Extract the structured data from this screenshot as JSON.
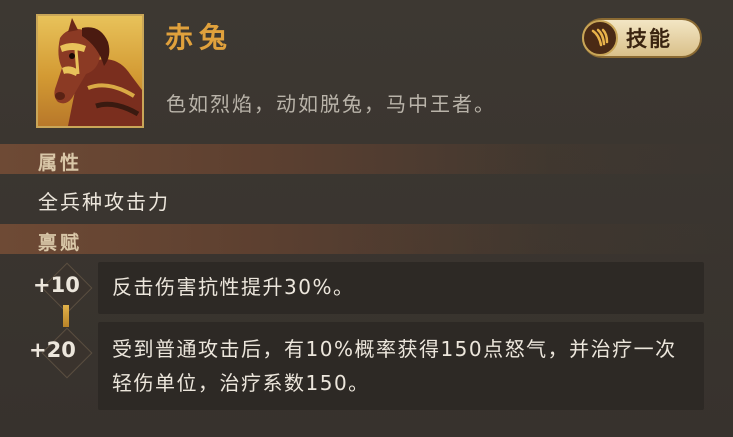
{
  "card": {
    "name": "赤兔",
    "description": "色如烈焰，动如脱兔，马中王者。",
    "skill_button_label": "技能",
    "skill_icon": "claw-icon",
    "portrait": "horse-portrait"
  },
  "attributes": {
    "title": "属性",
    "value": "全兵种攻击力"
  },
  "talents": {
    "title": "禀赋",
    "items": [
      {
        "level": "+10",
        "text": "反击伤害抗性提升30%。"
      },
      {
        "level": "+20",
        "text": "受到普通攻击后，有10%概率获得150点怒气，并治疗一次轻伤单位，治疗系数150。"
      }
    ]
  },
  "colors": {
    "name": "#e0a13c",
    "section_bar": "#6e4a35",
    "text": "#ece6dc",
    "muted": "#b9b3a9"
  }
}
